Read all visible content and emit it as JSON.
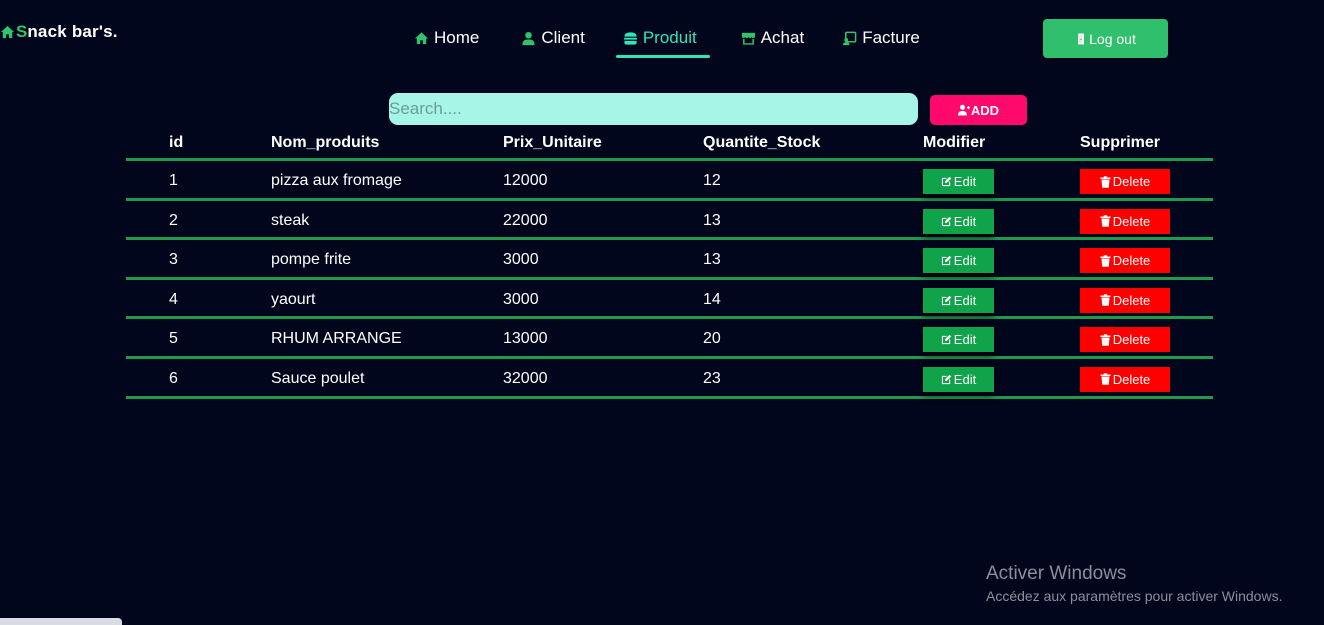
{
  "brand": {
    "s": "S",
    "text": "nack bar's."
  },
  "nav": {
    "home": "Home",
    "client": "Client",
    "produit": "Produit",
    "achat": "Achat",
    "facture": "Facture",
    "active": "Produit"
  },
  "logout_label": "Log out",
  "search": {
    "placeholder": "Search...."
  },
  "add_label": "ADD",
  "table": {
    "headers": [
      "id",
      "Nom_produits",
      "Prix_Unitaire",
      "Quantite_Stock",
      "Modifier",
      "Supprimer"
    ],
    "rows": [
      {
        "id": "1",
        "nom": "pizza aux fromage",
        "prix": "12000",
        "qte": "12"
      },
      {
        "id": "2",
        "nom": "steak",
        "prix": "22000",
        "qte": "13"
      },
      {
        "id": "3",
        "nom": "pompe frite",
        "prix": "3000",
        "qte": "13"
      },
      {
        "id": "4",
        "nom": "yaourt",
        "prix": "3000",
        "qte": "14"
      },
      {
        "id": "5",
        "nom": "RHUM ARRANGE",
        "prix": "13000",
        "qte": "20"
      },
      {
        "id": "6",
        "nom": "Sauce poulet",
        "prix": "32000",
        "qte": "23"
      }
    ],
    "edit_label": "Edit",
    "delete_label": "Delete"
  },
  "watermark": {
    "title": "Activer Windows",
    "subtitle": "Accédez aux paramètres pour activer Windows."
  },
  "colors": {
    "background": "#01061c",
    "accent_green": "#2fbf6d",
    "active_nav": "#2ee6b6",
    "add_pink": "#ff0a6c",
    "delete_red": "#ff0000",
    "search_bg": "#a6f5e6"
  },
  "icons": {
    "brand": "home-icon",
    "home": "home-icon",
    "client": "user-icon",
    "produit": "burger-icon",
    "achat": "store-icon",
    "facture": "invoice-icon",
    "logout": "door-icon",
    "add": "user-plus-icon",
    "edit": "edit-icon",
    "delete": "trash-icon"
  }
}
